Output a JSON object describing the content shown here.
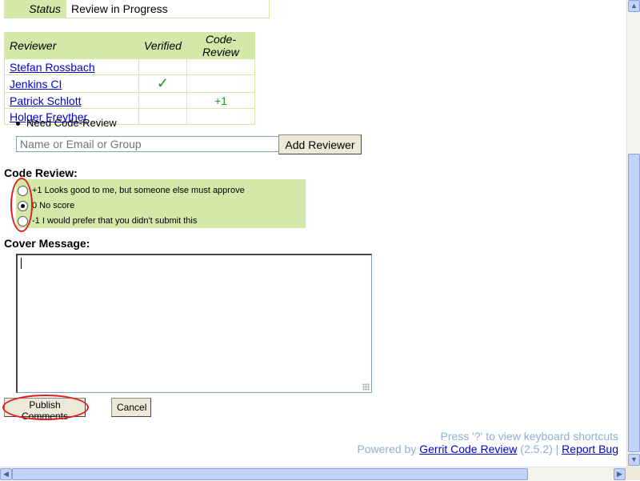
{
  "status": {
    "label": "Status",
    "value": "Review in Progress"
  },
  "reviewers": {
    "headers": {
      "name": "Reviewer",
      "verified": "Verified",
      "code_review": "Code-Review"
    },
    "rows": [
      {
        "name": "Stefan Rossbach",
        "verified": "",
        "code_review": ""
      },
      {
        "name": "Jenkins CI",
        "verified": "✓",
        "code_review": ""
      },
      {
        "name": "Patrick Schlott",
        "verified": "",
        "code_review": "+1"
      },
      {
        "name": "Holger Freyther",
        "verified": "",
        "code_review": ""
      }
    ],
    "need": "Need Code-Review",
    "add_placeholder": "Name or Email or Group",
    "add_button": "Add Reviewer"
  },
  "code_review": {
    "title": "Code Review:",
    "options": [
      {
        "label": "+1 Looks good to me, but someone else must approve",
        "checked": false
      },
      {
        "label": "0 No score",
        "checked": true
      },
      {
        "label": "-1 I would prefer that you didn't submit this",
        "checked": false
      }
    ]
  },
  "cover_message": {
    "title": "Cover Message:",
    "value": ""
  },
  "buttons": {
    "publish": "Publish Comments",
    "cancel": "Cancel"
  },
  "footer": {
    "shortcuts": "Press '?' to view keyboard shortcuts",
    "powered_by": "Powered by",
    "gerrit_link": "Gerrit Code Review",
    "version": "(2.5.2)",
    "separator": "|",
    "report_bug": "Report Bug"
  },
  "colors": {
    "accent_green": "#d4e9a9",
    "highlight_red": "#e0201c",
    "link": "#0000cc"
  }
}
